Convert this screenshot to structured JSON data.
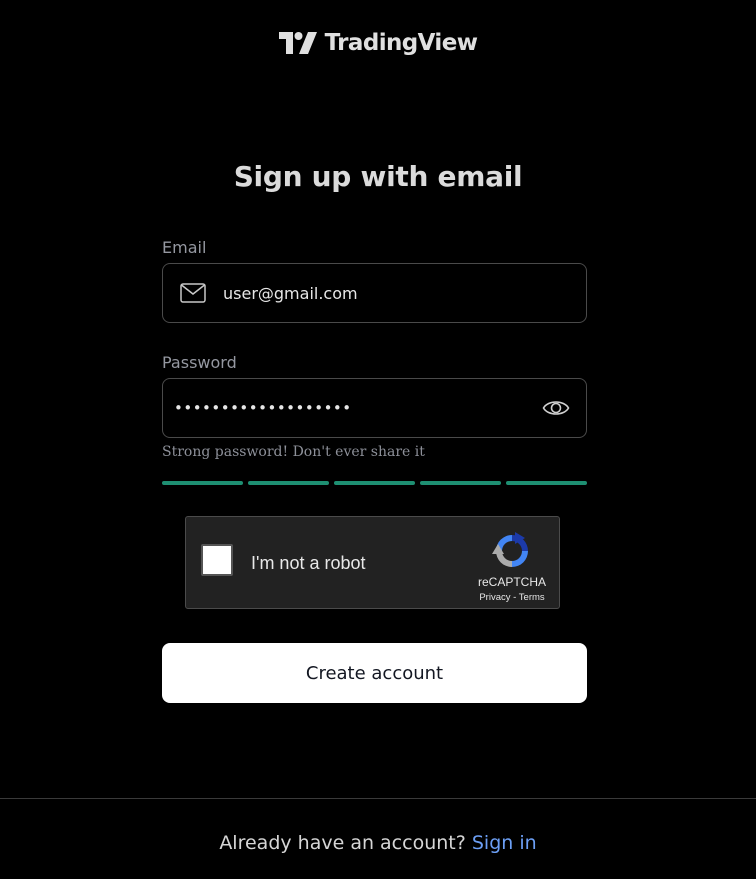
{
  "brand": {
    "logo_text": "TradingView",
    "logo_icon": "tradingview-logo-mark"
  },
  "page": {
    "title": "Sign up with email"
  },
  "email": {
    "label": "Email",
    "value": "user@gmail.com",
    "icon": "envelope-icon"
  },
  "password": {
    "label": "Password",
    "masked_value": "•••••••••••••••••••",
    "toggle_icon": "eye-icon",
    "hint": "Strong password! Don't ever share it",
    "strength_segments_filled": 5,
    "strength_segments_total": 5,
    "strength_color": "#1e8f72"
  },
  "captcha": {
    "label": "I'm not a robot",
    "brand": "reCAPTCHA",
    "privacy_link": "Privacy",
    "separator": " - ",
    "terms_link": "Terms",
    "checked": false,
    "icon": "recaptcha-logo-icon"
  },
  "actions": {
    "create_account_label": "Create account"
  },
  "footer": {
    "prompt": "Already have an account? ",
    "signin_link": "Sign in",
    "link_color": "#6c9ff5"
  }
}
